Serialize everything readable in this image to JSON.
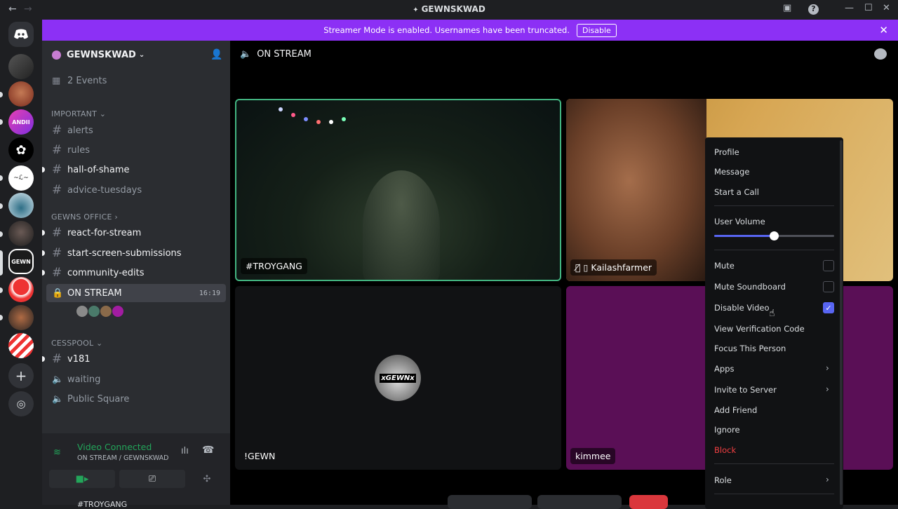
{
  "window": {
    "title": "GEWNSKWAD",
    "back_arrow": "←",
    "forward_arrow": "→"
  },
  "banner": {
    "text": "Streamer Mode is enabled. Usernames have been truncated.",
    "button": "Disable"
  },
  "server": {
    "name": "GEWNSKWAD",
    "events": "2 Events"
  },
  "categories": {
    "important": "IMPORTANT",
    "gewns_office": "GEWNS OFFICE",
    "cesspool": "CESSPOOL"
  },
  "channels": {
    "alerts": "alerts",
    "rules": "rules",
    "hall_of_shame": "hall-of-shame",
    "advice_tuesdays": "advice-tuesdays",
    "react_for_stream": "react-for-stream",
    "start_screen_submissions": "start-screen-submissions",
    "community_edits": "community-edits",
    "on_stream": "ON STREAM",
    "on_stream_time": "16:19",
    "v181": "v181",
    "waiting": "waiting",
    "public_square": "Public Square"
  },
  "voice": {
    "status": "Video Connected",
    "location": "ON STREAM / GEWNSKWAD",
    "next_user_partial": "#TROYGANG"
  },
  "stage": {
    "channel_title": "ON STREAM",
    "tiles": [
      {
        "name": "#TROYGANG"
      },
      {
        "name": "Kailashfarmer"
      },
      {
        "name": "!GEWN",
        "avatar_text": "xGEWNx"
      },
      {
        "name": "kimmee"
      }
    ]
  },
  "context_menu": {
    "profile": "Profile",
    "message": "Message",
    "start_call": "Start a Call",
    "user_volume": "User Volume",
    "user_volume_level": 0.5,
    "mute": "Mute",
    "mute_checked": false,
    "mute_soundboard": "Mute Soundboard",
    "mute_soundboard_checked": false,
    "disable_video": "Disable Video",
    "disable_video_checked": true,
    "view_verification_code": "View Verification Code",
    "focus_this_person": "Focus This Person",
    "apps": "Apps",
    "invite_to_server": "Invite to Server",
    "add_friend": "Add Friend",
    "ignore": "Ignore",
    "block": "Block",
    "role": "Role"
  },
  "colors": {
    "accent": "#5865f2",
    "banner": "#8c30f5",
    "connected_green": "#23a55a",
    "danger": "#f23f42",
    "speaking_border": "#43b581"
  }
}
